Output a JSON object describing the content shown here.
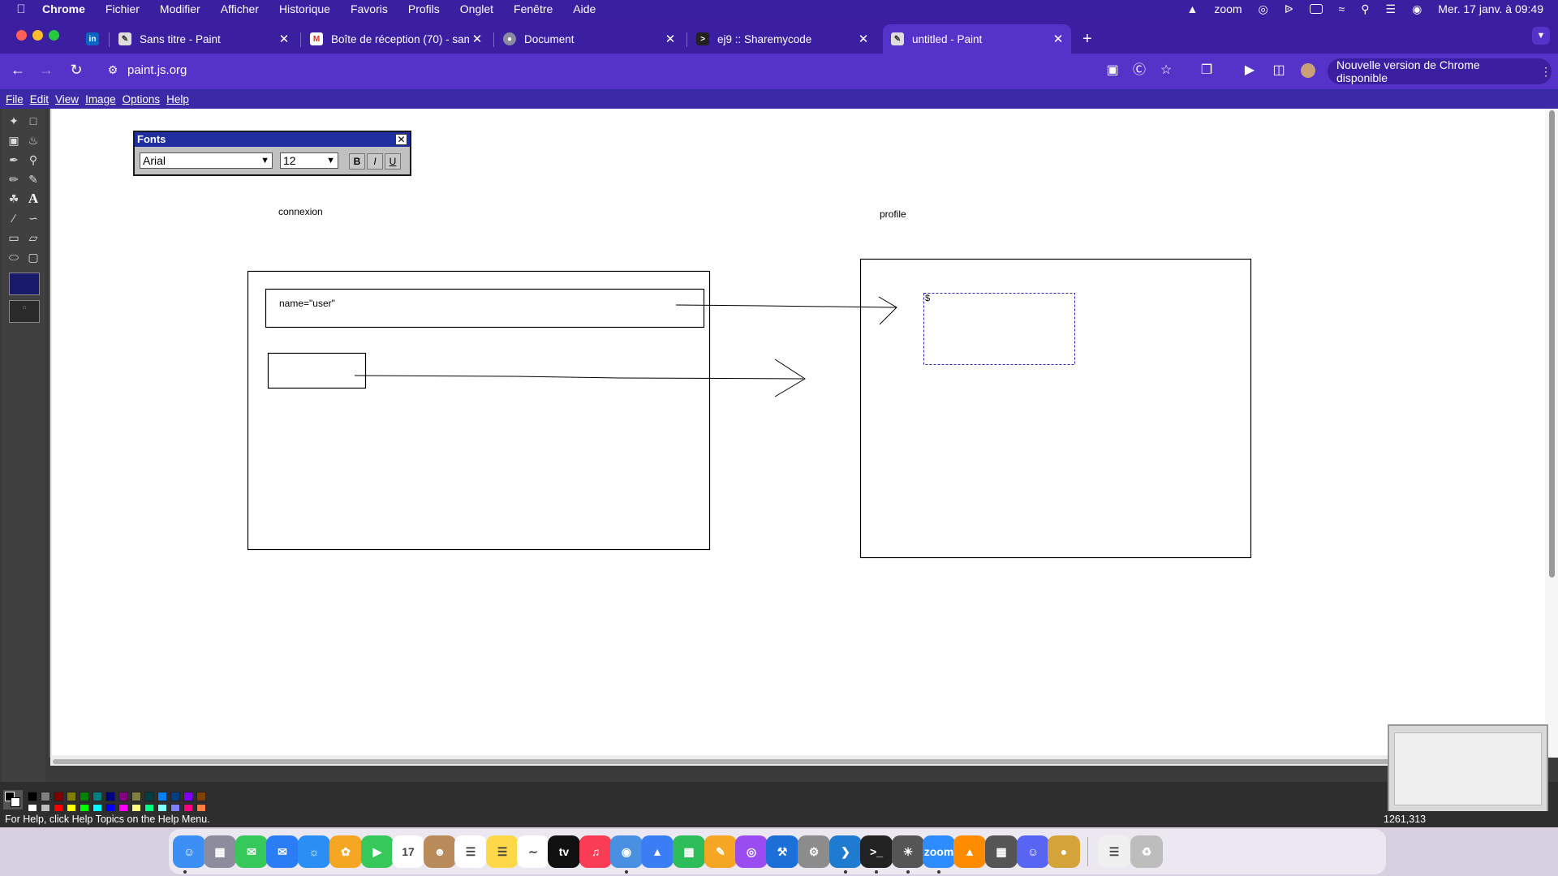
{
  "menubar": {
    "app": "Chrome",
    "items": [
      "Fichier",
      "Modifier",
      "Afficher",
      "Historique",
      "Favoris",
      "Profils",
      "Onglet",
      "Fenêtre",
      "Aide"
    ],
    "zoom_label": "zoom",
    "datetime": "Mer. 17 janv. à 09:49"
  },
  "tabs": [
    {
      "title": "",
      "icon": "linkedin-icon"
    },
    {
      "title": "Sans titre - Paint",
      "icon": "paint-icon"
    },
    {
      "title": "Boîte de réception (70) - sam",
      "icon": "gmail-icon"
    },
    {
      "title": "Document",
      "icon": "document-icon"
    },
    {
      "title": "ej9 :: Sharemycode",
      "icon": "sharemycode-icon"
    },
    {
      "title": "untitled - Paint",
      "icon": "paint-icon",
      "active": true
    }
  ],
  "toolbar": {
    "url": "paint.js.org",
    "update_label": "Nouvelle version de Chrome disponible"
  },
  "paint": {
    "menu": [
      "File",
      "Edit",
      "View",
      "Image",
      "Options",
      "Help"
    ],
    "fonts_window": {
      "title": "Fonts",
      "font": "Arial",
      "size": "12",
      "bold": "B",
      "italic": "I",
      "underline": "U"
    },
    "diagram": {
      "label_connexion": "connexion",
      "label_profile": "profile",
      "input_text": "name=\"user\"",
      "text_cursor": "$"
    },
    "status_help": "For Help, click Help Topics on the Help Menu.",
    "coords": "1261,313"
  },
  "colors": {
    "menubar": "#3a1fa0",
    "chrome_tab": "#5532c8",
    "selection_dash": "#2a2aa8"
  }
}
